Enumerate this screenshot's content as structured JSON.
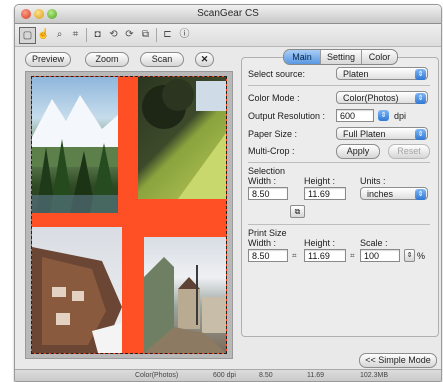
{
  "window": {
    "title": "ScanGear CS"
  },
  "toolbar": {
    "icons": [
      "crop-icon",
      "hand-icon",
      "zoom-icon",
      "multi-crop-icon",
      "auto-crop-icon",
      "rotate-left-icon",
      "rotate-right-icon",
      "mirror-icon",
      "crop-frame-icon",
      "info-icon"
    ]
  },
  "preview_buttons": {
    "preview": "Preview",
    "zoom": "Zoom",
    "scan": "Scan",
    "clear": "✕"
  },
  "tabs": [
    {
      "label": "Main"
    },
    {
      "label": "Setting"
    },
    {
      "label": "Color"
    }
  ],
  "main": {
    "select_source": {
      "label": "Select source:",
      "value": "Platen"
    },
    "color_mode": {
      "label": "Color Mode :",
      "value": "Color(Photos)"
    },
    "output_resolution": {
      "label": "Output Resolution :",
      "value": "600",
      "unit": "dpi"
    },
    "paper_size": {
      "label": "Paper Size :",
      "value": "Full Platen"
    },
    "multi_crop": {
      "label": "Multi-Crop :",
      "apply": "Apply",
      "reset": "Reset"
    },
    "selection": {
      "title": "Selection",
      "width_label": "Width :",
      "height_label": "Height :",
      "units_label": "Units :",
      "width": "8.50",
      "height": "11.69",
      "units": "inches"
    },
    "print_size": {
      "title": "Print Size",
      "width_label": "Width :",
      "height_label": "Height :",
      "scale_label": "Scale :",
      "width": "8.50",
      "height": "11.69",
      "scale": "100",
      "percent": "%"
    },
    "simple_mode": "<< Simple Mode"
  },
  "status": {
    "mode": "Color(Photos)",
    "resolution": "600 dpi",
    "width": "8.50",
    "height": "11.69",
    "size": "102.3MB"
  },
  "colors": {
    "accent": "#3f86e0",
    "crop_background": "#ff4f25"
  }
}
